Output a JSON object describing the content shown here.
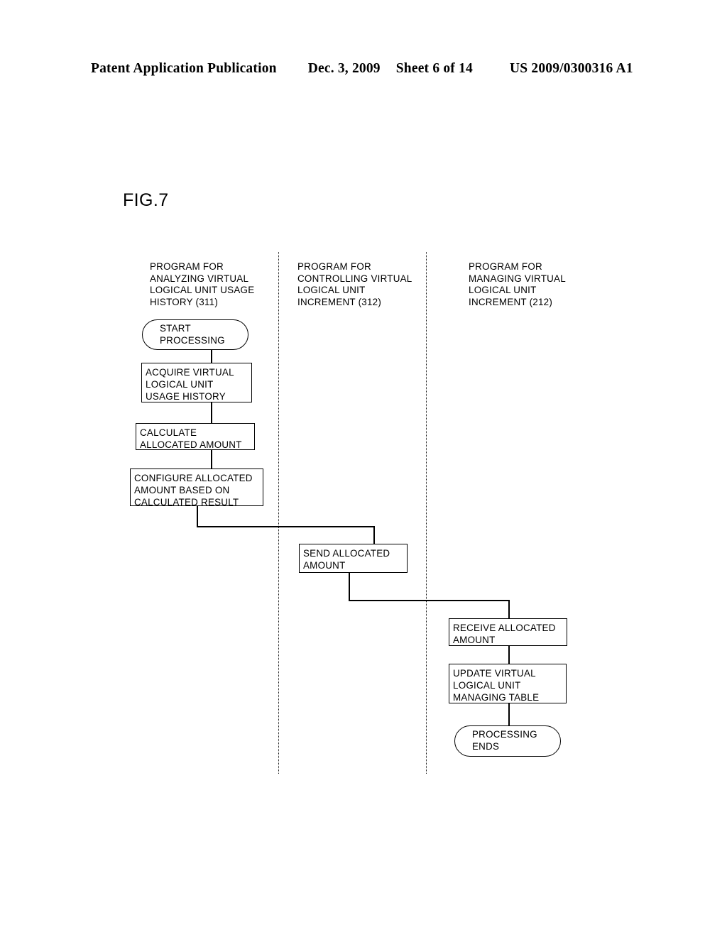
{
  "header": {
    "publication": "Patent Application Publication",
    "date": "Dec. 3, 2009",
    "sheet": "Sheet 6 of 14",
    "patent_number": "US 2009/0300316 A1"
  },
  "figure": {
    "label": "FIG.7"
  },
  "lanes": [
    {
      "id": "analyzing-usage-history",
      "header": "PROGRAM FOR\nANALYZING VIRTUAL\nLOGICAL UNIT USAGE\nHISTORY (311)",
      "reference": "311"
    },
    {
      "id": "controlling-increment",
      "header": "PROGRAM FOR\nCONTROLLING VIRTUAL\nLOGICAL UNIT\nINCREMENT (312)",
      "reference": "312"
    },
    {
      "id": "managing-increment",
      "header": "PROGRAM FOR\nMANAGING VIRTUAL\nLOGICAL UNIT\nINCREMENT (212)",
      "reference": "212"
    }
  ],
  "nodes": {
    "start": {
      "text": "START\nPROCESSING",
      "shape": "terminal",
      "lane": 0
    },
    "acquire": {
      "text": "ACQUIRE VIRTUAL\nLOGICAL UNIT\nUSAGE HISTORY",
      "shape": "process",
      "lane": 0
    },
    "calculate": {
      "text": "CALCULATE\nALLOCATED AMOUNT",
      "shape": "process",
      "lane": 0
    },
    "configure": {
      "text": "CONFIGURE ALLOCATED\nAMOUNT BASED ON\nCALCULATED RESULT",
      "shape": "process",
      "lane": 0
    },
    "send": {
      "text": "SEND ALLOCATED\nAMOUNT",
      "shape": "process",
      "lane": 1
    },
    "receive": {
      "text": "RECEIVE ALLOCATED\nAMOUNT",
      "shape": "process",
      "lane": 2
    },
    "update": {
      "text": "UPDATE VIRTUAL\nLOGICAL UNIT\nMANAGING TABLE",
      "shape": "process",
      "lane": 2
    },
    "end": {
      "text": "PROCESSING\nENDS",
      "shape": "terminal",
      "lane": 2
    }
  },
  "colors": {
    "ink": "#000000",
    "paper": "#ffffff"
  }
}
